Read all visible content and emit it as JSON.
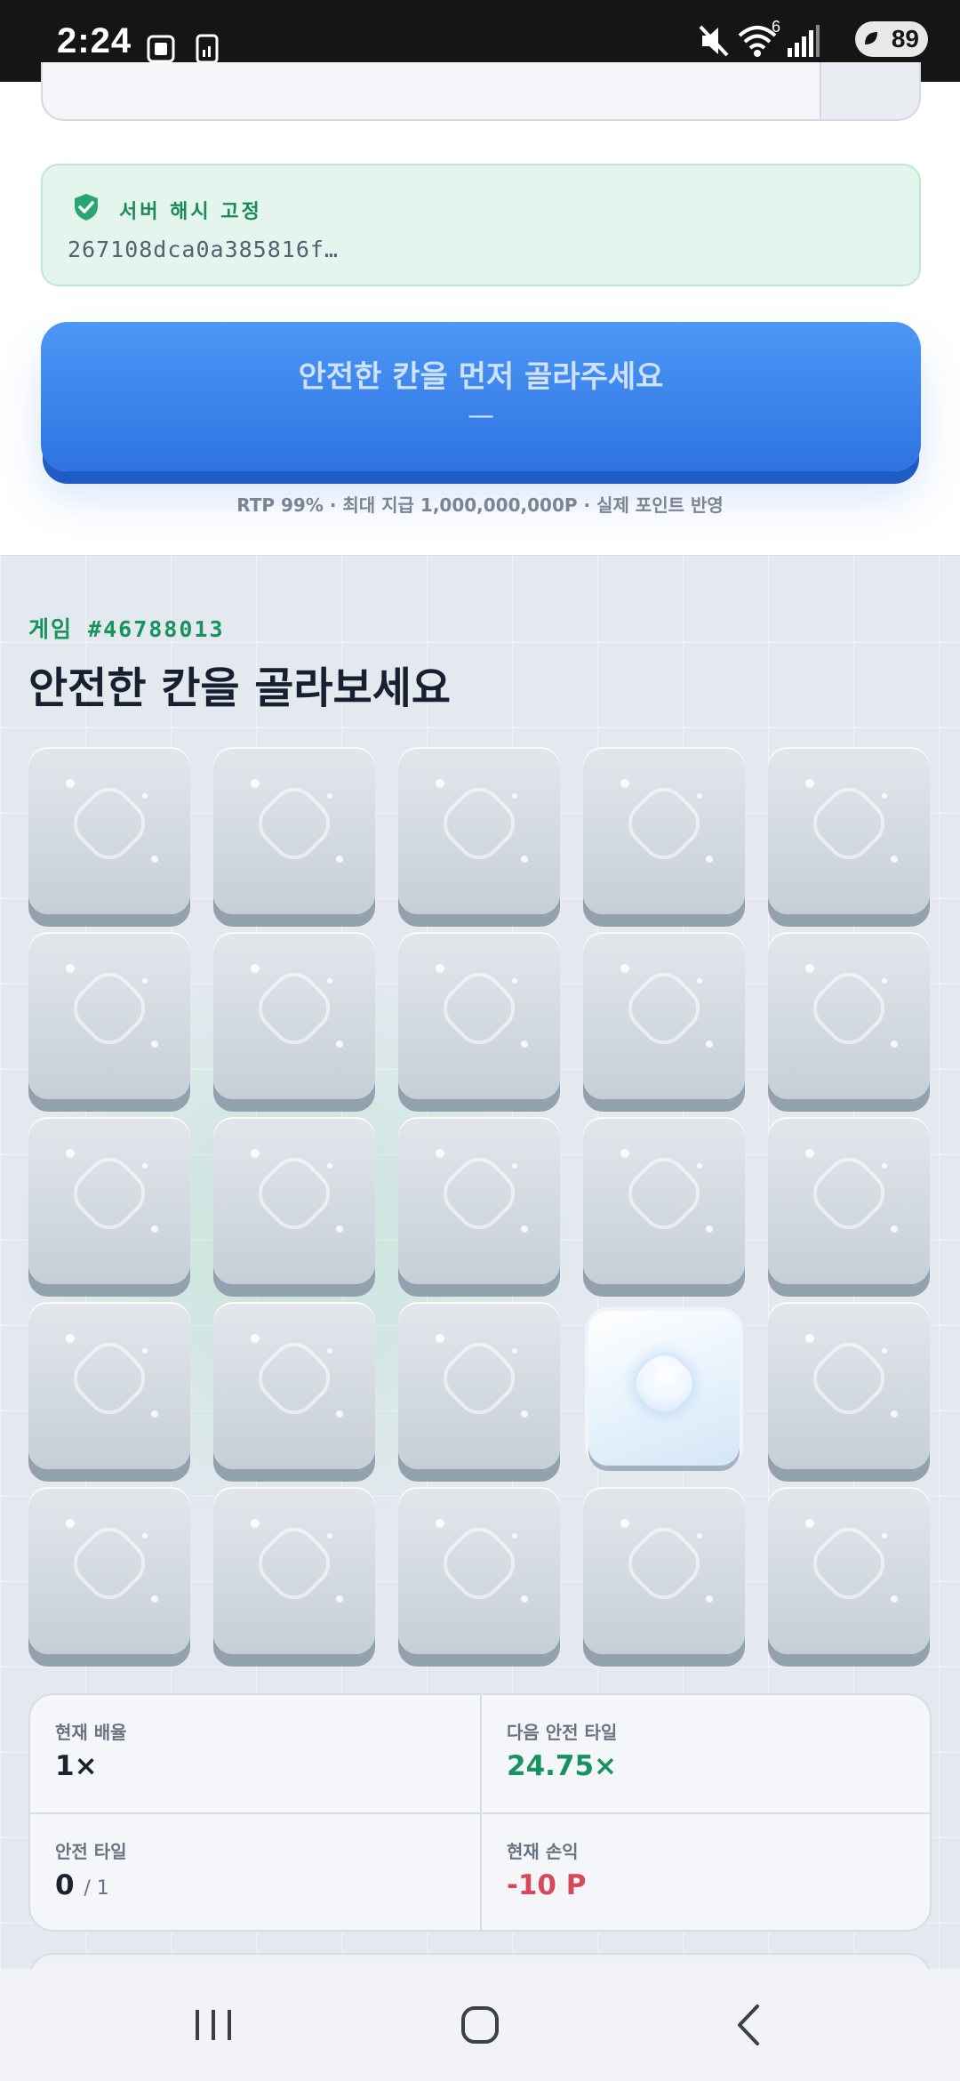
{
  "status_bar": {
    "time": "2:24",
    "left_icons": [
      "screenshot-icon",
      "sim-icon"
    ],
    "right_icons": [
      "mute-icon",
      "wifi-icon",
      "signal-icon"
    ],
    "wifi_badge": "6",
    "battery": "89"
  },
  "hash": {
    "label": "서버 해시 고정",
    "value": "267108dca0a385816f…"
  },
  "bet_button": {
    "label": "안전한 칸을 먼저 골라주세요",
    "sub": "—"
  },
  "rtp_note": "RTP 99% · 최대 지급 1,000,000,000P · 실제 포인트 반영",
  "game": {
    "id": "게임 #46788013",
    "title": "안전한 칸을 골라보세요",
    "grid_rows": 5,
    "grid_cols": 5,
    "selected_tile": 18
  },
  "stats": {
    "current_multiplier_label": "현재 배율",
    "current_multiplier_value": "1×",
    "next_multiplier_label": "다음 안전 타일",
    "next_multiplier_value": "24.75×",
    "safe_tiles_label": "안전 타일",
    "safe_tiles_value": "0",
    "safe_tiles_total": "/ 1",
    "profit_label": "현재 손익",
    "profit_value": "-10 P"
  },
  "colors": {
    "accent_blue": "#2e73e1",
    "green": "#17935d",
    "red": "#d9485a"
  },
  "nav_bar": [
    "recents-button",
    "home-button",
    "back-button"
  ]
}
